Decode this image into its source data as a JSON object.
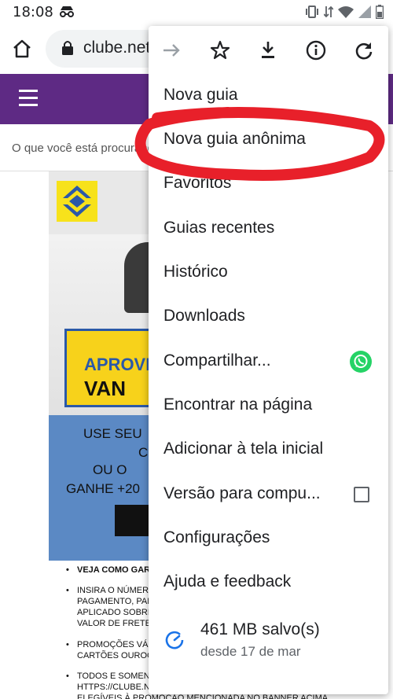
{
  "status_bar": {
    "time": "18:08",
    "icons": [
      "incognito-icon",
      "vibrate-icon",
      "data-transfer-icon",
      "wifi-icon",
      "signal-icon",
      "battery-icon"
    ]
  },
  "browser": {
    "url": "clube.netshoes.com.br",
    "icons": [
      "home-icon",
      "lock-icon"
    ]
  },
  "page": {
    "search_placeholder": "O que você está procurando?",
    "banner": {
      "line1": "APROVE",
      "line2": "VAN",
      "blue_lines": [
        "USE SEU",
        "C",
        "OU O",
        "GANHE +20"
      ]
    },
    "fine_print": [
      {
        "text": "VEJA COMO GAR",
        "bold": true
      },
      {
        "text": "INSIRA O NÚMER",
        "bold": false
      },
      {
        "text": "PAGAMENTO, PAR",
        "bold": false
      },
      {
        "text": "APLICADO SOBRE",
        "bold": false
      },
      {
        "text": "VALOR DE FRETE",
        "bold": false
      },
      {
        "text": "PROMOÇÕES VÁL",
        "bold": false
      },
      {
        "text": "CARTÕES OUROC",
        "bold": false
      },
      {
        "text": "TODOS E SOMENTE OS PRODUTOS DISPONIVEIS NO",
        "bold": false
      },
      {
        "text": "HTTPS://CLUBE.NETSHOES.COM.BR/BANCODOBRASIL SÃO",
        "bold": false
      },
      {
        "text": "ELEGÍVEIS À PROMOÇÃO MENCIONADA NO BANNER ACIMA",
        "bold": false
      }
    ]
  },
  "menu": {
    "top_icons": [
      "forward-icon",
      "star-icon",
      "download-icon",
      "info-icon",
      "reload-icon"
    ],
    "items": [
      {
        "label": "Nova guia"
      },
      {
        "label": "Nova guia anônima"
      },
      {
        "label": "Favoritos"
      },
      {
        "label": "Guias recentes"
      },
      {
        "label": "Histórico"
      },
      {
        "label": "Downloads"
      },
      {
        "label": "Compartilhar..."
      },
      {
        "label": "Encontrar na página"
      },
      {
        "label": "Adicionar à tela inicial"
      },
      {
        "label": "Versão para compu..."
      },
      {
        "label": "Configurações"
      },
      {
        "label": "Ajuda e feedback"
      }
    ],
    "data_saver": {
      "amount": "461 MB salvo(s)",
      "since": "desde 17 de mar"
    }
  },
  "colors": {
    "site_header": "#5e2a84",
    "annotation": "#e8202a",
    "whatsapp": "#25d366",
    "data_saver_icon": "#1a73e8"
  }
}
